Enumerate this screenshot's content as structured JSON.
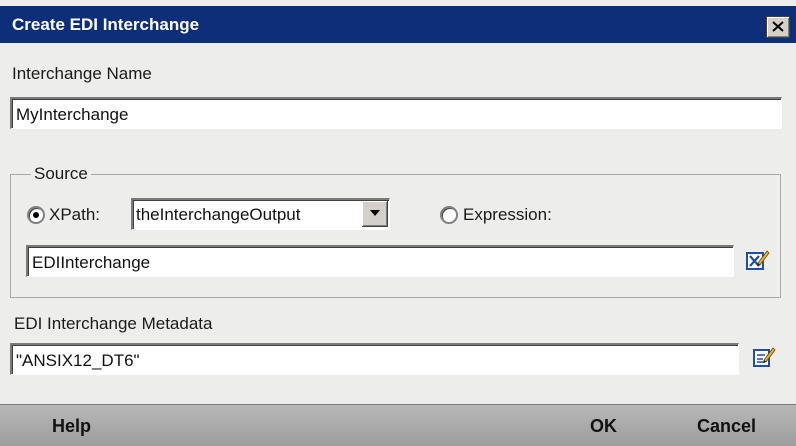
{
  "dialog": {
    "title": "Create EDI Interchange",
    "interchange_name_label": "Interchange Name",
    "interchange_name_value": "MyInterchange",
    "source": {
      "legend": "Source",
      "xpath_label": "XPath:",
      "xpath_selected": true,
      "xpath_value": "theInterchangeOutput",
      "expression_label": "Expression:",
      "expression_selected": false,
      "source_value": "EDIInterchange"
    },
    "metadata_label": "EDI Interchange Metadata",
    "metadata_value": "\"ANSIX12_DT6\""
  },
  "buttons": {
    "help": "Help",
    "ok": "OK",
    "cancel": "Cancel"
  },
  "icons": {
    "close": "close-icon",
    "xpath_editor": "xpath-editor-icon",
    "metadata_editor": "edit-icon",
    "dropdown": "chevron-down-icon"
  },
  "colors": {
    "titlebar": "#0d2f7a",
    "dialog_bg": "#ededeb",
    "bottombar": "#a8a8a8"
  }
}
